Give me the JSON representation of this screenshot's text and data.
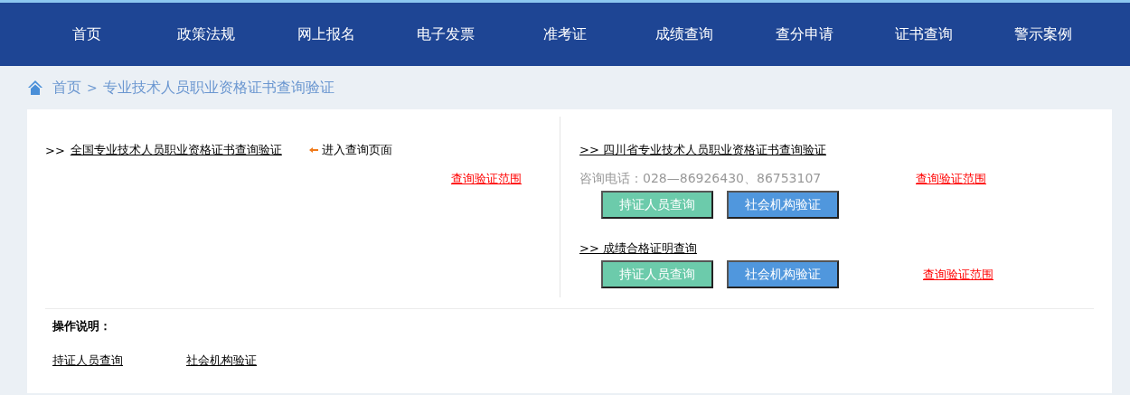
{
  "nav": [
    {
      "label": "首页"
    },
    {
      "label": "政策法规"
    },
    {
      "label": "网上报名"
    },
    {
      "label": "电子发票"
    },
    {
      "label": "准考证"
    },
    {
      "label": "成绩查询"
    },
    {
      "label": "查分申请"
    },
    {
      "label": "证书查询"
    },
    {
      "label": "警示案例"
    }
  ],
  "breadcrumb": {
    "home": "首页",
    "separator": ">",
    "current": "专业技术人员职业资格证书查询验证"
  },
  "national": {
    "prefix": ">>",
    "link": "全国专业技术人员职业资格证书查询验证",
    "enter": "进入查询页面",
    "scope": "查询验证范围"
  },
  "sichuan": {
    "link": ">> 四川省专业技术人员职业资格证书查询验证",
    "phone": "咨询电话：028—86926430、86753107",
    "scope": "查询验证范围",
    "buttons": [
      {
        "label": "持证人员查询",
        "color": "#6ccbab"
      },
      {
        "label": "社会机构验证",
        "color": "#5097dd"
      }
    ]
  },
  "scores": {
    "link": ">> 成绩合格证明查询",
    "scope": "查询验证范围",
    "buttons": [
      {
        "label": "持证人员查询",
        "color": "#6ccbab"
      },
      {
        "label": "社会机构验证",
        "color": "#5097dd"
      }
    ]
  },
  "instructions": {
    "title": "操作说明：",
    "links": [
      "持证人员查询",
      "社会机构验证"
    ]
  }
}
